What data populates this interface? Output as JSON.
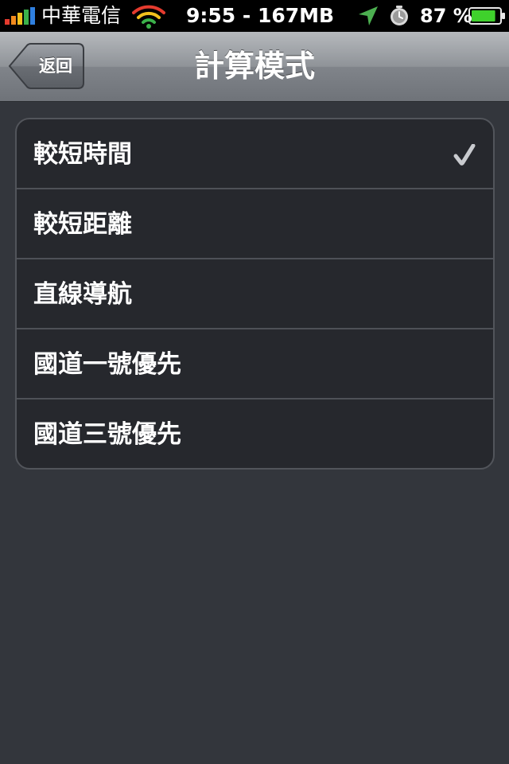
{
  "status_bar": {
    "carrier": "中華電信",
    "time": "9:55 - 167MB",
    "battery_percent": "87 %",
    "battery_level": 0.87,
    "icons": [
      "signal-icon",
      "wifi-icon",
      "location-arrow-icon",
      "alarm-clock-icon",
      "battery-icon"
    ]
  },
  "nav": {
    "back_label": "返回",
    "title": "計算模式",
    "back_icon": "back-arrow-icon"
  },
  "list": {
    "items": [
      {
        "label": "較短時間",
        "selected": true
      },
      {
        "label": "較短距離",
        "selected": false
      },
      {
        "label": "直線導航",
        "selected": false
      },
      {
        "label": "國道一號優先",
        "selected": false
      },
      {
        "label": "國道三號優先",
        "selected": false
      }
    ],
    "check_icon": "checkmark-icon"
  },
  "colors": {
    "background": "#33363c",
    "list_background": "#26282d",
    "list_border": "#52555b",
    "battery_green": "#3fd12c",
    "location_green": "#4caf50"
  }
}
